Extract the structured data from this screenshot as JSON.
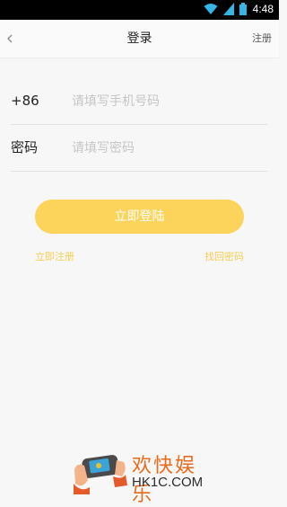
{
  "status_bar": {
    "time": "4:48",
    "icons": [
      "wifi-icon",
      "signal-icon",
      "battery-icon"
    ]
  },
  "nav": {
    "back_icon": "chevron-left-icon",
    "title": "登录",
    "right_label": "注册"
  },
  "form": {
    "phone": {
      "prefix": "+86",
      "placeholder": "请填写手机号码"
    },
    "password": {
      "label": "密码",
      "placeholder": "请填写密码"
    }
  },
  "login_button": {
    "label": "立即登陆"
  },
  "links": {
    "register": "立即注册",
    "forgot_password": "找回密码"
  },
  "watermark": {
    "title": "欢快娱乐",
    "site": "HK1C.COM"
  },
  "colors": {
    "accent": "#fdd45b",
    "link": "#f6cf55",
    "watermark": "#e76b1a"
  }
}
